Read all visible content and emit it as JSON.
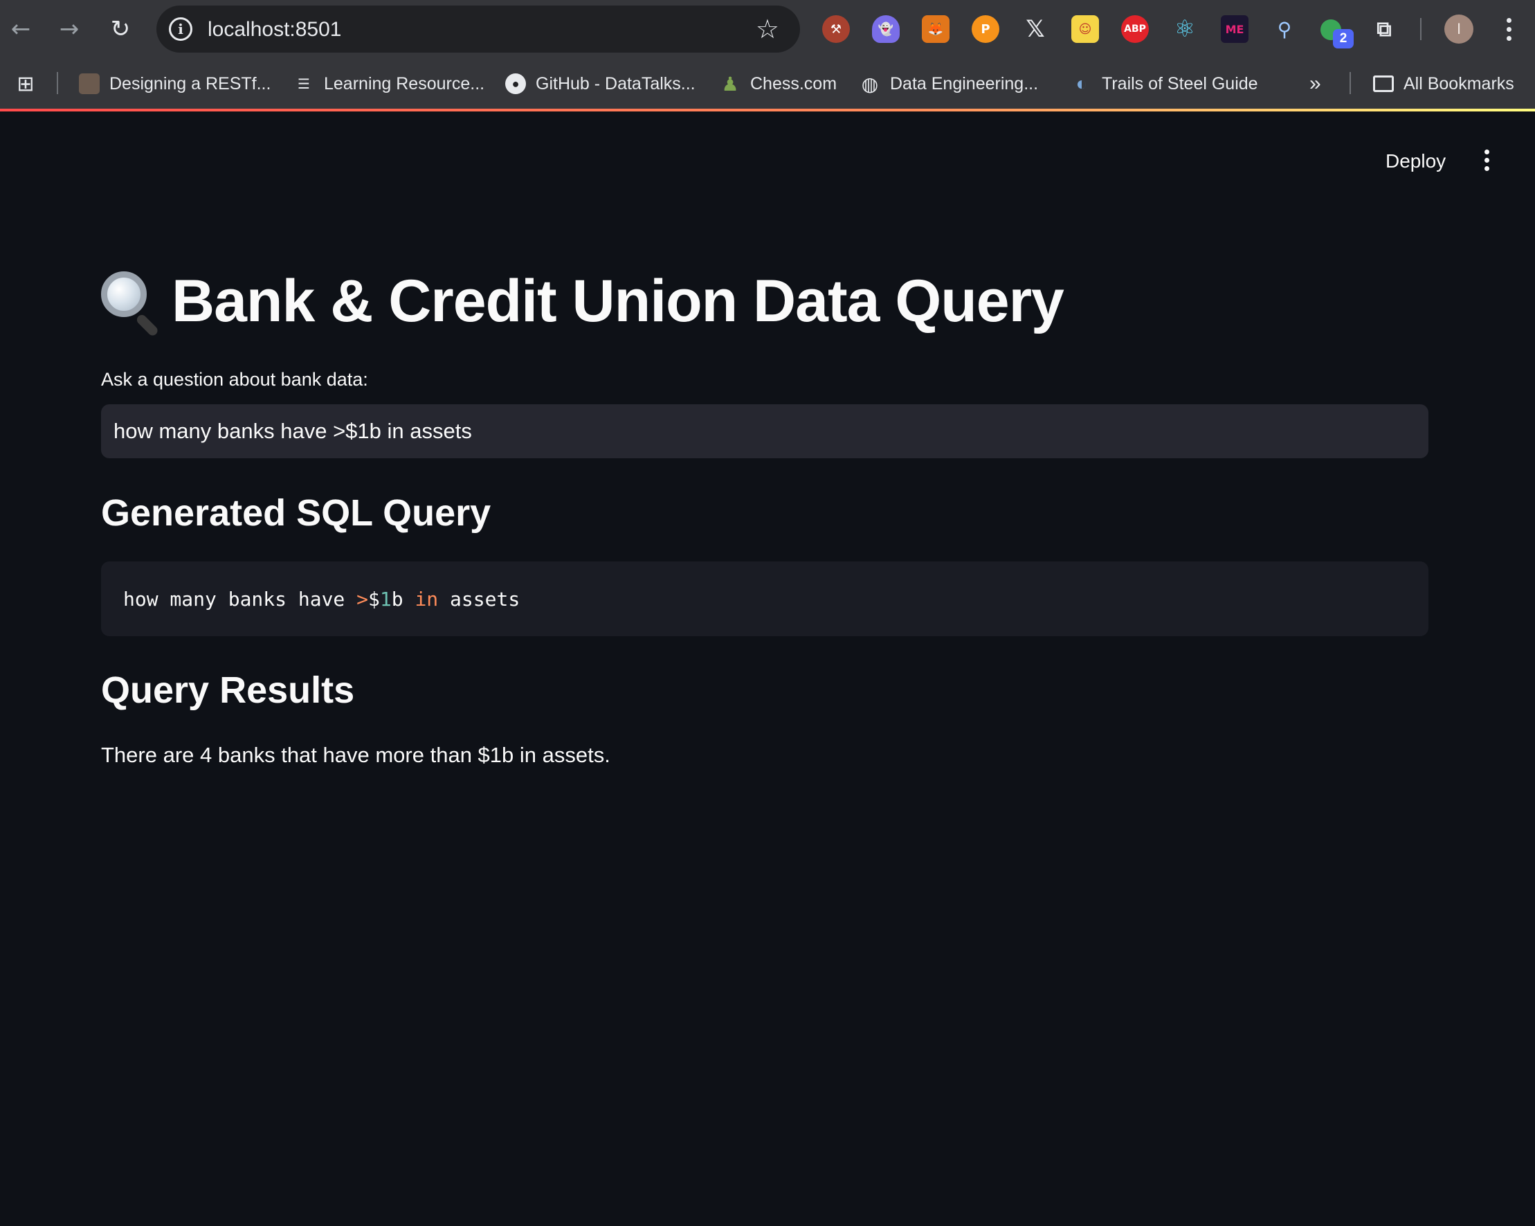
{
  "browser": {
    "url": "localhost:8501",
    "extension_icons": [
      "metamask-fox-icon",
      "pickaxe-icon",
      "ghost-icon",
      "p-coin-icon",
      "x-logo-icon",
      "cartoon-icon",
      "adblock-icon",
      "react-icon",
      "magic-eden-icon",
      "magnifier-icon",
      "puzzle-extension-icon"
    ],
    "extension_adblock_label": "ABP",
    "extension_magiceden_label": "ME",
    "extension_badge": "2",
    "profile_initial": "I"
  },
  "bookmarks": [
    {
      "label": "Designing a RESTf...",
      "icon": "avatar-favicon"
    },
    {
      "label": "Learning Resource...",
      "icon": "db-favicon"
    },
    {
      "label": "GitHub - DataTalks...",
      "icon": "github-icon"
    },
    {
      "label": "Chess.com",
      "icon": "pawn-icon"
    },
    {
      "label": "Data Engineering...",
      "icon": "globe-icon"
    },
    {
      "label": "Trails of Steel Guide",
      "icon": "planet-icon"
    }
  ],
  "bookmarks_more": "»",
  "all_bookmarks": "All Bookmarks",
  "app": {
    "deploy_label": "Deploy",
    "title": "Bank & Credit Union Data Query",
    "title_icon": "🔍",
    "input_label": "Ask a question about bank data:",
    "input_value": "how many banks have >$1b in assets",
    "sql_heading": "Generated SQL Query",
    "sql_tokens": {
      "t1": "how many banks have ",
      "t2": ">",
      "t3": "$",
      "t4": "1",
      "t5": "b ",
      "t6": "in",
      "t7": " assets"
    },
    "results_heading": "Query Results",
    "result_text": "There are 4 banks that have more than $1b in assets."
  },
  "colors": {
    "background": "#0e1117",
    "input_bg": "#262730",
    "code_bg": "#1a1c24",
    "accent_gradient_start": "#ff4b4b",
    "accent_gradient_end": "#fffd80"
  }
}
